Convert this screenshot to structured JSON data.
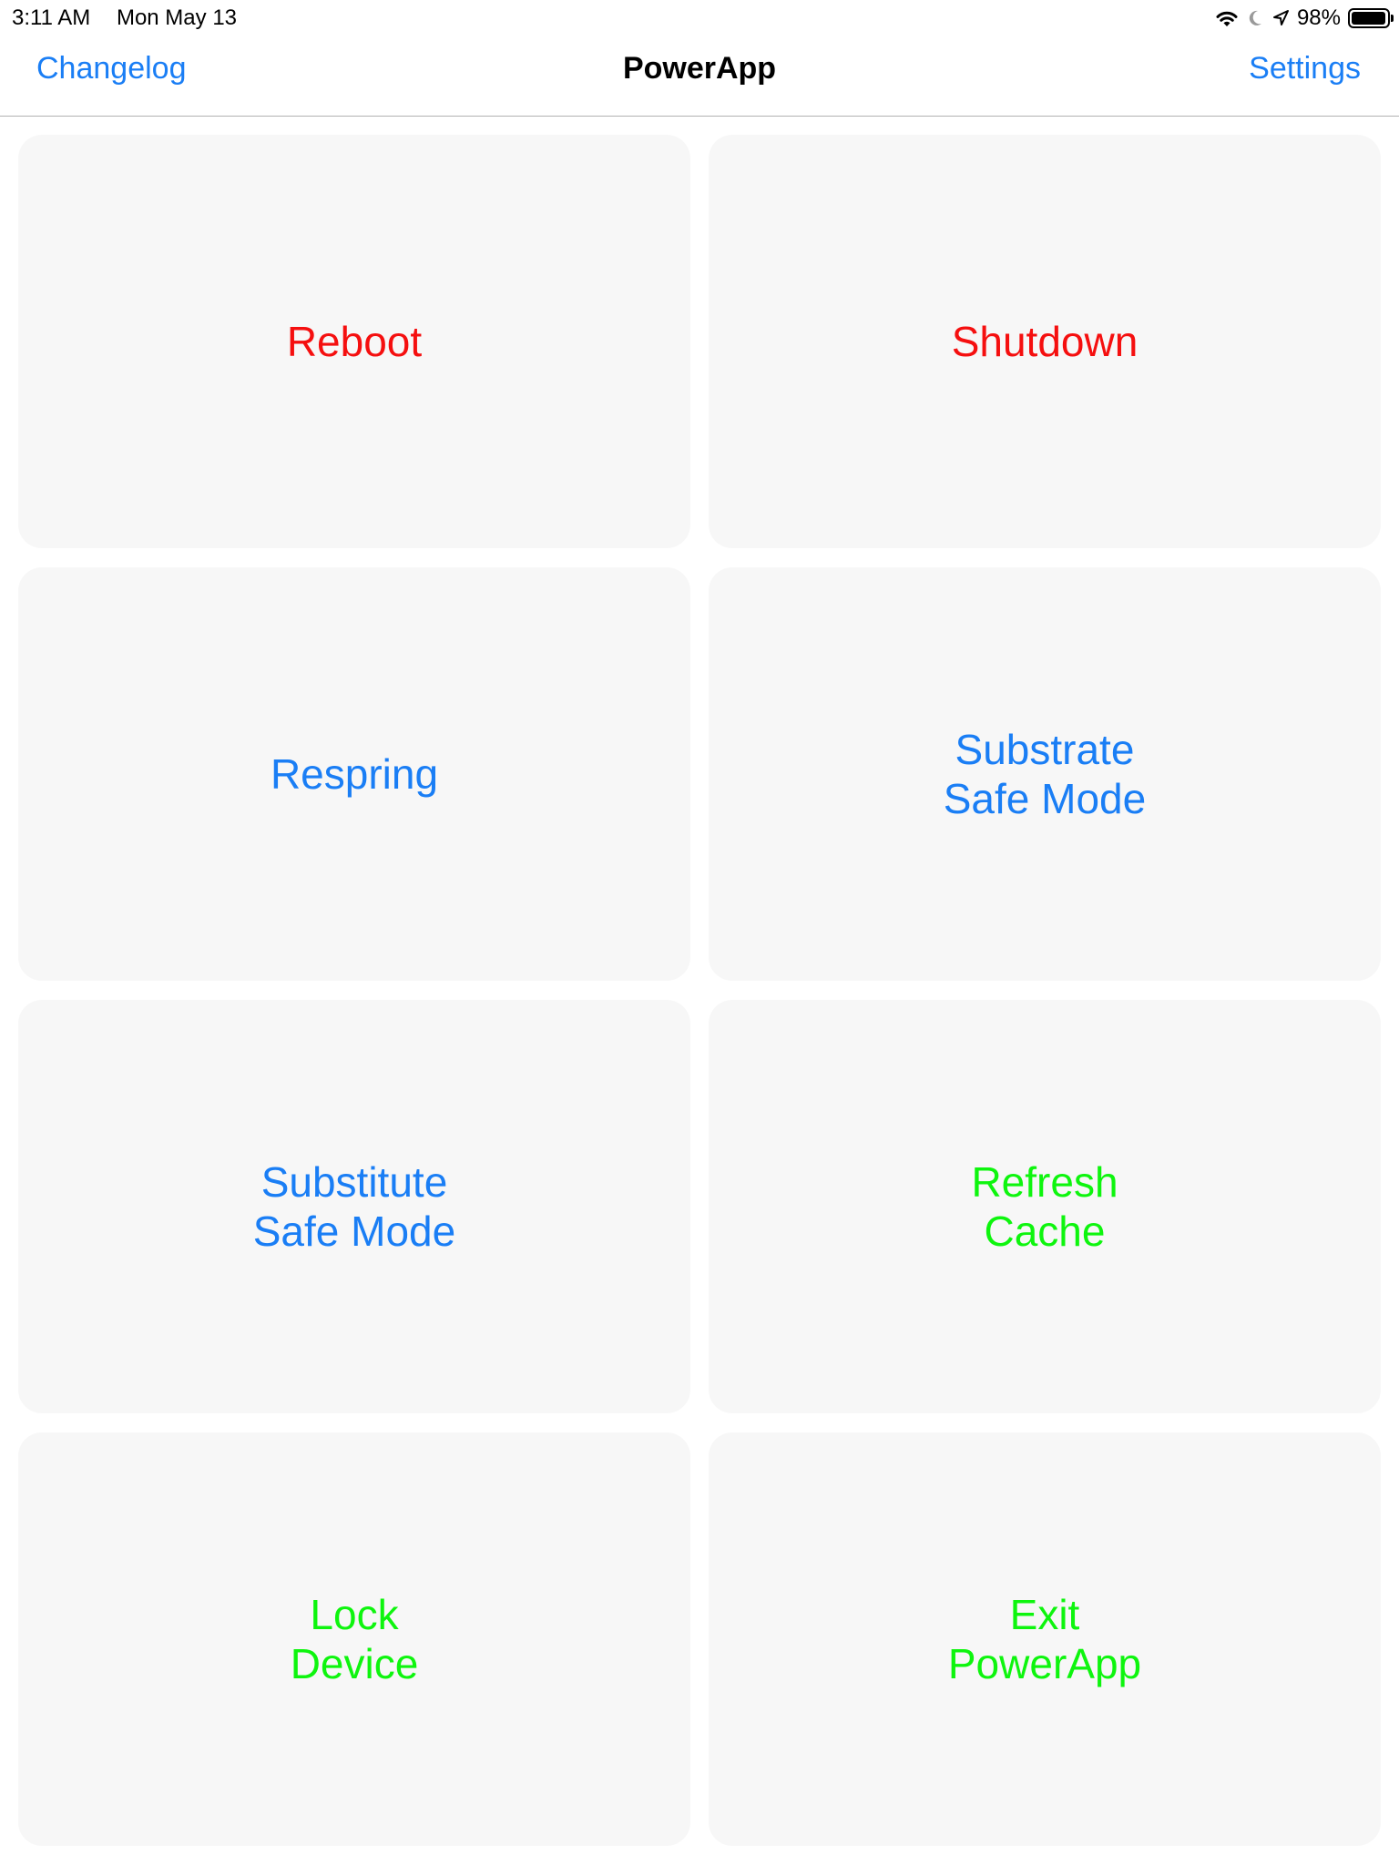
{
  "status_bar": {
    "time": "3:11 AM",
    "date": "Mon May 13",
    "battery_percent": "98%",
    "battery_level": 0.98,
    "icons": [
      "wifi-icon",
      "moon-icon",
      "location-arrow-icon",
      "battery-icon"
    ]
  },
  "nav": {
    "left_label": "Changelog",
    "title": "PowerApp",
    "right_label": "Settings"
  },
  "colors": {
    "red": "#f50f0f",
    "blue": "#1a7ef5",
    "green": "#0ef50e",
    "tile_bg": "#f7f7f7"
  },
  "tiles": [
    {
      "label": "Reboot",
      "color": "#f50f0f"
    },
    {
      "label": "Shutdown",
      "color": "#f50f0f"
    },
    {
      "label": "Respring",
      "color": "#1a7ef5"
    },
    {
      "label": "Substrate\nSafe Mode",
      "color": "#1a7ef5"
    },
    {
      "label": "Substitute\nSafe Mode",
      "color": "#1a7ef5"
    },
    {
      "label": "Refresh\nCache",
      "color": "#0ef50e"
    },
    {
      "label": "Lock\nDevice",
      "color": "#0ef50e"
    },
    {
      "label": "Exit\nPowerApp",
      "color": "#0ef50e"
    }
  ]
}
